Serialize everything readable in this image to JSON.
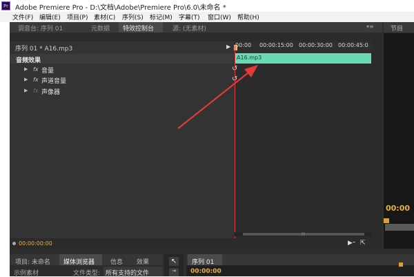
{
  "window": {
    "icon_text": "Pr",
    "title": "Adobe Premiere Pro - D:\\文档\\Adobe\\Premiere Pro\\6.0\\未命名 *"
  },
  "menu": [
    "文件(F)",
    "编辑(E)",
    "项目(P)",
    "素材(C)",
    "序列(S)",
    "标记(M)",
    "字幕(T)",
    "窗口(W)",
    "帮助(H)"
  ],
  "top_tabs": {
    "mixer": "调音台: 序列 01",
    "metadata": "元数据",
    "effect_controls": "特效控制台",
    "source": "源: (无素材)",
    "menu_glyph": "▾≡",
    "right_tab": "节目"
  },
  "effect_controls": {
    "sequence_name": "序列 01 * A16.mp3",
    "section": "音频效果",
    "effects": [
      {
        "label": "音量",
        "fx": "fx",
        "reset": true
      },
      {
        "label": "声道音量",
        "fx": "fx",
        "reset": true
      },
      {
        "label": "声像器",
        "fx": "fx",
        "reset": false
      }
    ],
    "timecode": "00:00:00:00"
  },
  "timeline": {
    "ticks": [
      "00:00",
      "00:00:15:00",
      "00:00:30:00",
      "00:00:45:0"
    ],
    "clip_label": "A16.mp3"
  },
  "right_panel": {
    "timecode": "00:00"
  },
  "bottom": {
    "left_tabs": [
      "项目: 未命名",
      "媒体浏览器",
      "信息",
      "效果"
    ],
    "left_body": {
      "view_label": "示例素材",
      "filetype_label": "文件类型:",
      "filetype_value": "所有支持的文件"
    },
    "right_tab": "序列 01",
    "right_timecode": "00:00:00"
  },
  "colors": {
    "timecode": "#e9b23c",
    "clip": "#69d9b6",
    "playhead": "#e04848"
  }
}
